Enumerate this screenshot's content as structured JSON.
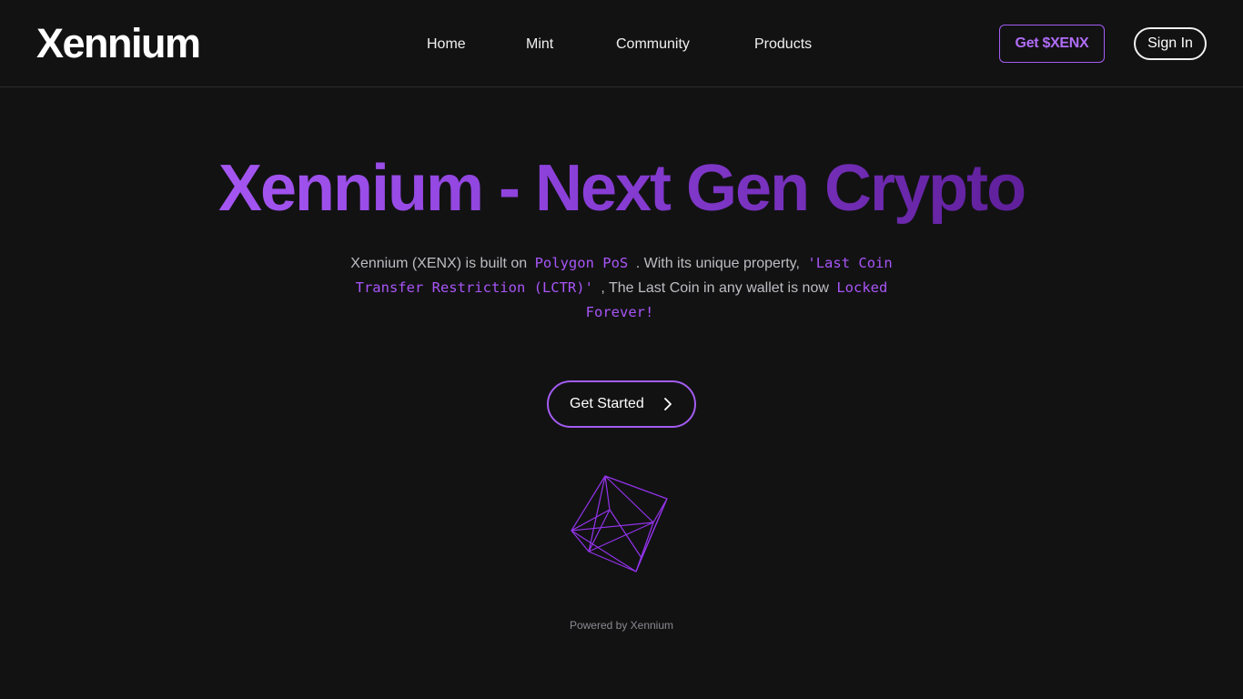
{
  "header": {
    "logo": "Xennium",
    "nav": [
      {
        "label": "Home"
      },
      {
        "label": "Mint"
      },
      {
        "label": "Community"
      },
      {
        "label": "Products"
      }
    ],
    "get_token_label": "Get $XENX",
    "sign_in_label": "Sign In"
  },
  "hero": {
    "title": "Xennium - Next Gen Crypto",
    "desc": {
      "part1": "Xennium (XENX) is built on",
      "code1": "Polygon PoS",
      "part2": ". With its unique property,",
      "code2": "'Last Coin Transfer Restriction (LCTR)'",
      "part3": ", The Last Coin in any wallet is now",
      "code3": "Locked Forever!"
    },
    "cta_label": "Get Started"
  },
  "footer": {
    "powered_by": "Powered by Xennium"
  },
  "colors": {
    "background": "#121213",
    "accent": "#a855f7",
    "accent_dark": "#5f1f9a"
  },
  "icons": {
    "cta_icon": "chevron-right-icon",
    "illustration": "wireframe-polyhedron-icon"
  }
}
